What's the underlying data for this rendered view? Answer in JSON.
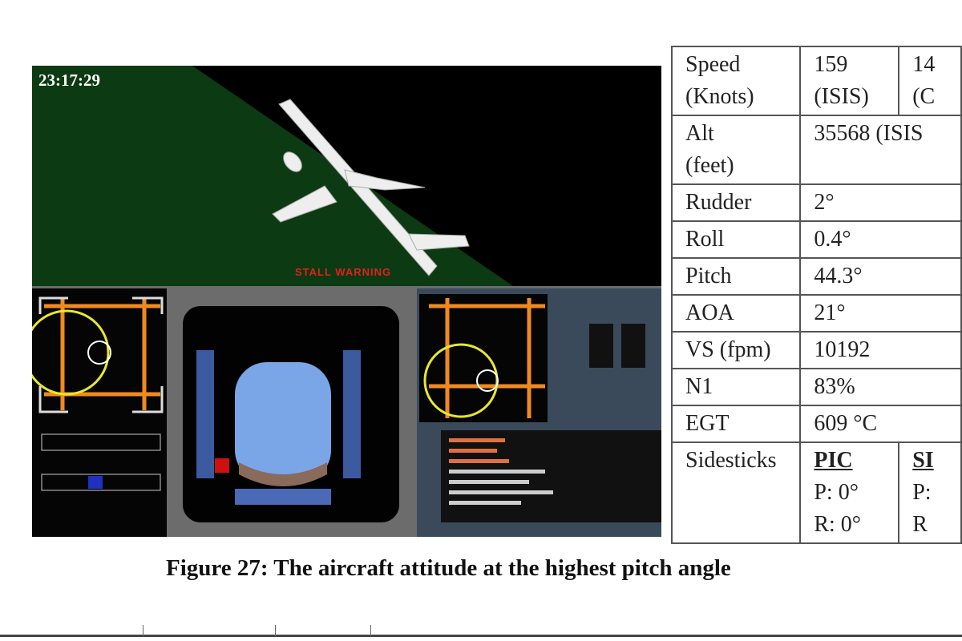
{
  "figure": {
    "timestamp": "23:17:29",
    "warning": "STALL WARNING",
    "colors": {
      "sky": "#0c3a12",
      "aircraft": "#f2f2f2",
      "warning": "#e02020",
      "sidestick_circle": "#e8e830",
      "grid": "#f08a20"
    }
  },
  "table": {
    "rows": [
      {
        "label": "Speed (Knots)",
        "label1": "Speed",
        "label2": "(Knots)",
        "v1": "159",
        "v1b": "(ISIS)",
        "v2": "14",
        "v2b": "(C"
      },
      {
        "label1": "Alt",
        "label2": "(feet)",
        "v1": "35568 (ISIS"
      },
      {
        "label1": "Rudder",
        "v1": "2°"
      },
      {
        "label1": "Roll",
        "v1": "0.4°"
      },
      {
        "label1": "Pitch",
        "v1": "44.3°"
      },
      {
        "label1": "AOA",
        "v1": "21°"
      },
      {
        "label1": "VS (fpm)",
        "v1": "10192"
      },
      {
        "label1": "N1",
        "v1": "83%"
      },
      {
        "label1": "EGT",
        "v1": "609 °C"
      }
    ],
    "sidesticks": {
      "label": "Sidesticks",
      "pic": {
        "title": "PIC",
        "p": "P: 0°",
        "r": "R: 0°"
      },
      "second": {
        "title": "SI",
        "p": "P:",
        "r": "R"
      }
    }
  },
  "caption": "Figure 27: The aircraft attitude at the highest pitch angle"
}
